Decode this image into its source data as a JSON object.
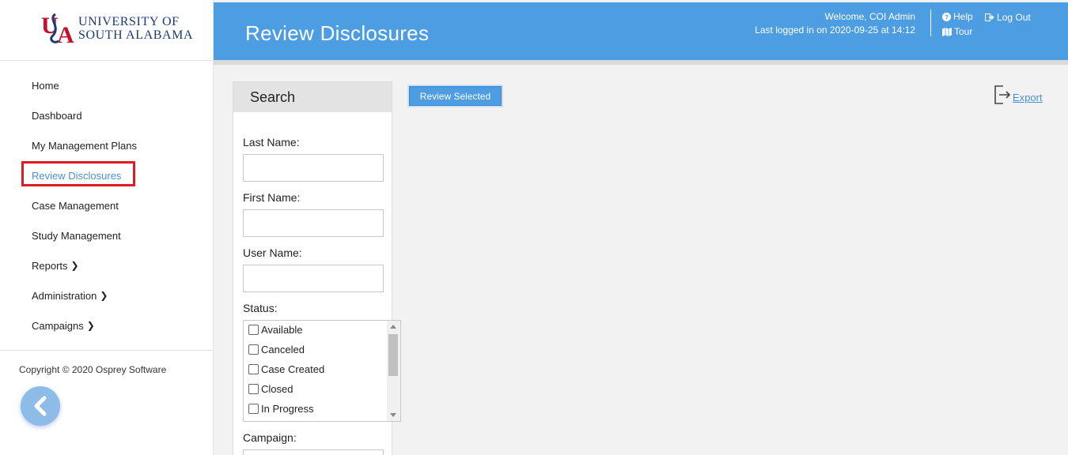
{
  "app": {
    "logo_line1": "UNIVERSITY OF",
    "logo_line2": "SOUTH ALABAMA",
    "brand_color": "#1b3a7a",
    "accent_red": "#e01b24",
    "header_color": "#4d9de3"
  },
  "header": {
    "title": "Review Disclosures",
    "welcome": "Welcome, COI Admin",
    "last_login": "Last logged in on 2020-09-25 at 14:12",
    "links": [
      {
        "label": "Help",
        "icon": "question-circle-icon"
      },
      {
        "label": "Log Out",
        "icon": "sign-out-icon"
      },
      {
        "label": "Tour",
        "icon": "map-icon"
      }
    ]
  },
  "sidebar": {
    "items": [
      {
        "label": "Home",
        "has_submenu": false
      },
      {
        "label": "Dashboard",
        "has_submenu": false
      },
      {
        "label": "My Management Plans",
        "has_submenu": false
      },
      {
        "label": "Review Disclosures",
        "has_submenu": false,
        "active": true
      },
      {
        "label": "Case Management",
        "has_submenu": false
      },
      {
        "label": "Study Management",
        "has_submenu": false
      },
      {
        "label": "Reports",
        "has_submenu": true
      },
      {
        "label": "Administration",
        "has_submenu": true
      },
      {
        "label": "Campaigns",
        "has_submenu": true
      }
    ],
    "copyright": "Copyright © 2020 Osprey Software",
    "collapse_icon": "chevron-left-icon"
  },
  "search": {
    "title": "Search",
    "last_name_label": "Last Name:",
    "last_name_value": "",
    "first_name_label": "First Name:",
    "first_name_value": "",
    "user_name_label": "User Name:",
    "user_name_value": "",
    "status_label": "Status:",
    "status_options": [
      {
        "label": "Available",
        "checked": false
      },
      {
        "label": "Canceled",
        "checked": false
      },
      {
        "label": "Case Created",
        "checked": false
      },
      {
        "label": "Closed",
        "checked": false
      },
      {
        "label": "In Progress",
        "checked": false
      }
    ],
    "campaign_label": "Campaign:"
  },
  "toolbar": {
    "review_selected_label": "Review Selected",
    "export_label": "Export",
    "export_icon": "export-icon"
  }
}
